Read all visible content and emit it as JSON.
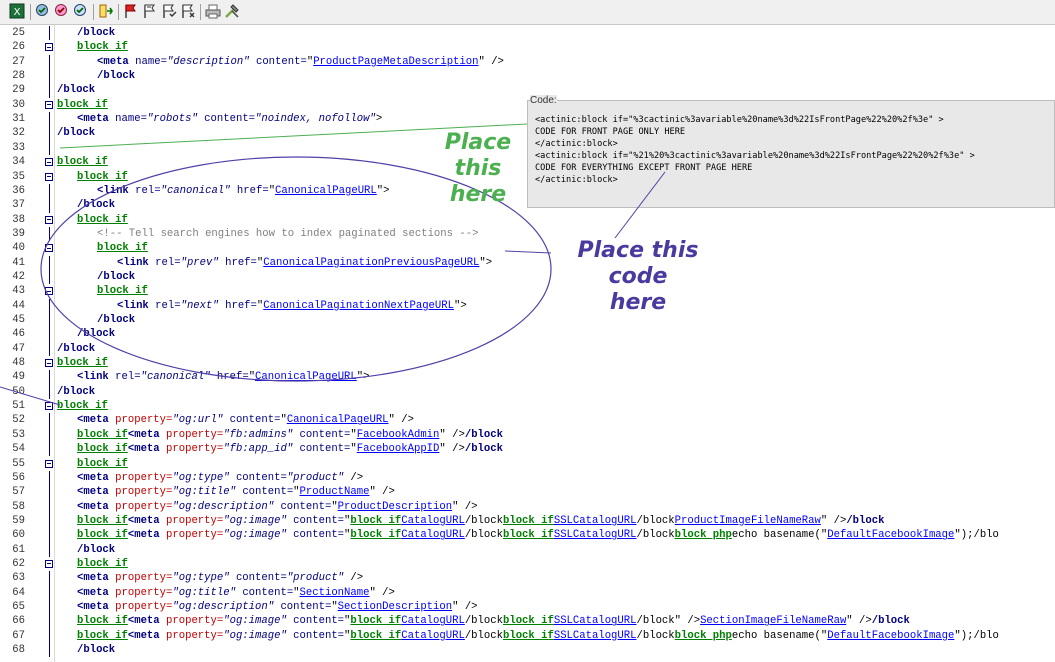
{
  "toolbar": {
    "icons": [
      "app-icon",
      "validate-icon",
      "validate-page-icon",
      "refresh-icon",
      "insert-icon",
      "flag-red-icon",
      "flag-outline-icon",
      "flag-check-icon",
      "flag-cross-icon",
      "print-icon",
      "tools-icon"
    ]
  },
  "lines": [
    {
      "n": "25",
      "fold": false,
      "indent": 1,
      "html": "<span class='tag'>/block</span>"
    },
    {
      "n": "26",
      "fold": true,
      "indent": 1,
      "html": "<span class='kw'>block if</span>"
    },
    {
      "n": "27",
      "fold": false,
      "indent": 2,
      "html": "<span class='tag'>&lt;meta</span> <span class='attrb'>name=</span><span class='str'>\"description\"</span> <span class='attrb'>content=</span><span class='pl'>\"</span><span class='link'>ProductPageMetaDescription</span><span class='pl'>\" /&gt;</span>"
    },
    {
      "n": "28",
      "fold": false,
      "indent": 2,
      "html": "<span class='tag'>/block</span>"
    },
    {
      "n": "29",
      "fold": false,
      "indent": 0,
      "html": "<span class='tag'>/block</span>"
    },
    {
      "n": "30",
      "fold": true,
      "indent": 0,
      "html": "<span class='kw'>block if</span>"
    },
    {
      "n": "31",
      "fold": false,
      "indent": 1,
      "html": "<span class='tag'>&lt;meta</span> <span class='attrb'>name=</span><span class='str'>\"robots\"</span> <span class='attrb'>content=</span><span class='str'>\"noindex, nofollow\"</span><span class='pl'>&gt;</span>"
    },
    {
      "n": "32",
      "fold": false,
      "indent": 0,
      "html": "<span class='tag'>/block</span>"
    },
    {
      "n": "33",
      "fold": false,
      "indent": 0,
      "html": ""
    },
    {
      "n": "34",
      "fold": true,
      "indent": 0,
      "html": "<span class='kw'>block if</span>"
    },
    {
      "n": "35",
      "fold": true,
      "indent": 1,
      "html": "<span class='kw'>block if</span>"
    },
    {
      "n": "36",
      "fold": false,
      "indent": 2,
      "html": "<span class='tag'>&lt;link</span> <span class='attrb'>rel=</span><span class='str'>\"canonical\"</span> <span class='attrb'>href=</span><span class='pl'>\"</span><span class='link'>CanonicalPageURL</span><span class='pl'>\"&gt;</span>"
    },
    {
      "n": "37",
      "fold": false,
      "indent": 1,
      "html": "<span class='tag'>/block</span>"
    },
    {
      "n": "38",
      "fold": true,
      "indent": 1,
      "html": "<span class='kw'>block if</span>"
    },
    {
      "n": "39",
      "fold": false,
      "indent": 2,
      "html": "<span class='cmt'>&lt;!-- Tell search engines how to index paginated sections --&gt;</span>"
    },
    {
      "n": "40",
      "fold": true,
      "indent": 2,
      "html": "<span class='kw'>block if</span>"
    },
    {
      "n": "41",
      "fold": false,
      "indent": 3,
      "html": "<span class='tag'>&lt;link</span> <span class='attrb'>rel=</span><span class='str'>\"prev\"</span> <span class='attrb'>href=</span><span class='pl'>\"</span><span class='link'>CanonicalPaginationPreviousPageURL</span><span class='pl'>\"&gt;</span>"
    },
    {
      "n": "42",
      "fold": false,
      "indent": 2,
      "html": "<span class='tag'>/block</span>"
    },
    {
      "n": "43",
      "fold": true,
      "indent": 2,
      "html": "<span class='kw'>block if</span>"
    },
    {
      "n": "44",
      "fold": false,
      "indent": 3,
      "html": "<span class='tag'>&lt;link</span> <span class='attrb'>rel=</span><span class='str'>\"next\"</span> <span class='attrb'>href=</span><span class='pl'>\"</span><span class='link'>CanonicalPaginationNextPageURL</span><span class='pl'>\"&gt;</span>"
    },
    {
      "n": "45",
      "fold": false,
      "indent": 2,
      "html": "<span class='tag'>/block</span>"
    },
    {
      "n": "46",
      "fold": false,
      "indent": 1,
      "html": "<span class='tag'>/block</span>"
    },
    {
      "n": "47",
      "fold": false,
      "indent": 0,
      "html": "<span class='tag'>/block</span>"
    },
    {
      "n": "48",
      "fold": true,
      "indent": 0,
      "html": "<span class='kw'>block if</span>"
    },
    {
      "n": "49",
      "fold": false,
      "indent": 1,
      "html": "<span class='tag'>&lt;link</span> <span class='attrb'>rel=</span><span class='str'>\"canonical\"</span> <span class='attrb'>href=</span><span class='pl'>\"</span><span class='link'>CanonicalPageURL</span><span class='pl'>\"&gt;</span>"
    },
    {
      "n": "50",
      "fold": false,
      "indent": 0,
      "html": "<span class='tag'>/block</span>"
    },
    {
      "n": "51",
      "fold": true,
      "indent": 0,
      "html": "<span class='kw'>block if</span>"
    },
    {
      "n": "52",
      "fold": false,
      "indent": 1,
      "html": "<span class='tag'>&lt;meta</span> <span class='attr'>property=</span><span class='str'>\"og:url\"</span> <span class='attrb'>content=</span><span class='pl'>\"</span><span class='link'>CanonicalPageURL</span><span class='pl'>\" /&gt;</span>"
    },
    {
      "n": "53",
      "fold": false,
      "indent": 1,
      "html": "<span class='kw'>block if</span><span class='tag'>&lt;meta</span> <span class='attr'>property=</span><span class='str'>\"fb:admins\"</span> <span class='attrb'>content=</span><span class='pl'>\"</span><span class='link'>FacebookAdmin</span><span class='pl'>\" /&gt;</span><span class='tag'>/block</span>"
    },
    {
      "n": "54",
      "fold": false,
      "indent": 1,
      "html": "<span class='kw'>block if</span><span class='tag'>&lt;meta</span> <span class='attr'>property=</span><span class='str'>\"fb:app_id\"</span> <span class='attrb'>content=</span><span class='pl'>\"</span><span class='link'>FacebookAppID</span><span class='pl'>\" /&gt;</span><span class='tag'>/block</span>"
    },
    {
      "n": "55",
      "fold": true,
      "indent": 1,
      "html": "<span class='kw'>block if</span>"
    },
    {
      "n": "56",
      "fold": false,
      "indent": 1,
      "html": "<span class='tag'>&lt;meta</span> <span class='attr'>property=</span><span class='str'>\"og:type\"</span> <span class='attrb'>content=</span><span class='str'>\"product\"</span> <span class='pl'>/&gt;</span>"
    },
    {
      "n": "57",
      "fold": false,
      "indent": 1,
      "html": "<span class='tag'>&lt;meta</span> <span class='attr'>property=</span><span class='str'>\"og:title\"</span> <span class='attrb'>content=</span><span class='pl'>\"</span><span class='link'>ProductName</span><span class='pl'>\" /&gt;</span>"
    },
    {
      "n": "58",
      "fold": false,
      "indent": 1,
      "html": "<span class='tag'>&lt;meta</span> <span class='attr'>property=</span><span class='str'>\"og:description\"</span> <span class='attrb'>content=</span><span class='pl'>\"</span><span class='link'>ProductDescription</span><span class='pl'>\" /&gt;</span>"
    },
    {
      "n": "59",
      "fold": false,
      "indent": 1,
      "html": "<span class='kw'>block if</span><span class='tag'>&lt;meta</span> <span class='attr'>property=</span><span class='str'>\"og:image\"</span> <span class='attrb'>content=</span><span class='pl'>\"</span><span class='kw'>block if</span><span class='link'>CatalogURL</span><span class='pl'>/block</span><span class='kw'>block if</span><span class='link'>SSLCatalogURL</span><span class='pl'>/block</span><span class='link'>ProductImageFileNameRaw</span><span class='pl'>\" /&gt;</span><span class='tag'>/block</span>"
    },
    {
      "n": "60",
      "fold": false,
      "indent": 1,
      "html": "<span class='kw'>block if</span><span class='tag'>&lt;meta</span> <span class='attr'>property=</span><span class='str'>\"og:image\"</span> <span class='attrb'>content=</span><span class='pl'>\"</span><span class='kw'>block if</span><span class='link'>CatalogURL</span><span class='pl'>/block</span><span class='kw'>block if</span><span class='link'>SSLCatalogURL</span><span class='pl'>/block</span><span class='kw'>block php</span><span class='pl'>echo basename(\"</span><span class='link'>DefaultFacebookImage</span><span class='pl'>\");/blo</span>"
    },
    {
      "n": "61",
      "fold": false,
      "indent": 1,
      "html": "<span class='tag'>/block</span>"
    },
    {
      "n": "62",
      "fold": true,
      "indent": 1,
      "html": "<span class='kw'>block if</span>"
    },
    {
      "n": "63",
      "fold": false,
      "indent": 1,
      "html": "<span class='tag'>&lt;meta</span> <span class='attr'>property=</span><span class='str'>\"og:type\"</span> <span class='attrb'>content=</span><span class='str'>\"product\"</span> <span class='pl'>/&gt;</span>"
    },
    {
      "n": "64",
      "fold": false,
      "indent": 1,
      "html": "<span class='tag'>&lt;meta</span> <span class='attr'>property=</span><span class='str'>\"og:title\"</span> <span class='attrb'>content=</span><span class='pl'>\"</span><span class='link'>SectionName</span><span class='pl'>\" /&gt;</span>"
    },
    {
      "n": "65",
      "fold": false,
      "indent": 1,
      "html": "<span class='tag'>&lt;meta</span> <span class='attr'>property=</span><span class='str'>\"og:description\"</span> <span class='attrb'>content=</span><span class='pl'>\"</span><span class='link'>SectionDescription</span><span class='pl'>\" /&gt;</span>"
    },
    {
      "n": "66",
      "fold": false,
      "indent": 1,
      "html": "<span class='kw'>block if</span><span class='tag'>&lt;meta</span> <span class='attr'>property=</span><span class='str'>\"og:image\"</span> <span class='attrb'>content=</span><span class='pl'>\"</span><span class='kw'>block if</span><span class='link'>CatalogURL</span><span class='pl'>/block</span><span class='kw'>block if</span><span class='link'>SSLCatalogURL</span><span class='pl'>/block\" /&gt;</span><span class='link'>SectionImageFileNameRaw</span><span class='pl'>\" /&gt;</span><span class='tag'>/block</span>"
    },
    {
      "n": "67",
      "fold": false,
      "indent": 1,
      "html": "<span class='kw'>block if</span><span class='tag'>&lt;meta</span> <span class='attr'>property=</span><span class='str'>\"og:image\"</span> <span class='attrb'>content=</span><span class='pl'>\"</span><span class='kw'>block if</span><span class='link'>CatalogURL</span><span class='pl'>/block</span><span class='kw'>block if</span><span class='link'>SSLCatalogURL</span><span class='pl'>/block</span><span class='kw'>block php</span><span class='pl'>echo basename(\"</span><span class='link'>DefaultFacebookImage</span><span class='pl'>\");/blo</span>"
    },
    {
      "n": "68",
      "fold": false,
      "indent": 1,
      "html": "<span class='tag'>/block</span>"
    }
  ],
  "popup": {
    "caption": "Code:",
    "lines": [
      "<actinic:block if=\"%3cactinic%3avariable%20name%3d%22IsFrontPage%22%20%2f%3e\" >",
      "CODE FOR FRONT PAGE ONLY HERE",
      "</actinic:block>",
      "<actinic:block if=\"%21%20%3cactinic%3avariable%20name%3d%22IsFrontPage%22%20%2f%3e\" >",
      "CODE FOR EVERYTHING EXCEPT FRONT PAGE HERE",
      "</actinic:block>"
    ]
  },
  "annotations": {
    "green": [
      "Place this",
      "here"
    ],
    "purple": [
      "Place this code",
      "here"
    ]
  },
  "colors": {
    "green_annotation": "#4caf50",
    "purple_annotation": "#4a3aa0",
    "keyword": "#008000",
    "link": "#0000ff"
  }
}
